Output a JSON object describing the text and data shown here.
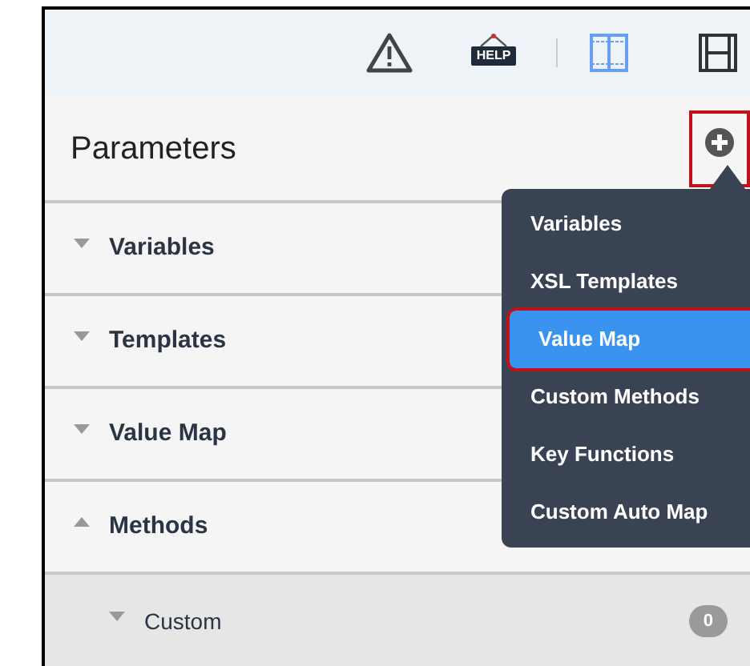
{
  "toolbar": {
    "help_sign_label": "HELP"
  },
  "panel": {
    "title": "Parameters",
    "add_button": {
      "highlighted": true
    }
  },
  "sections": [
    {
      "label": "Variables",
      "expanded": false
    },
    {
      "label": "Templates",
      "expanded": false
    },
    {
      "label": "Value Map",
      "expanded": false
    },
    {
      "label": "Methods",
      "expanded": true,
      "children": [
        {
          "label": "Custom",
          "expanded": false,
          "count": "0"
        }
      ]
    }
  ],
  "add_menu": {
    "items": [
      {
        "label": "Variables",
        "selected": false,
        "highlighted": false
      },
      {
        "label": "XSL Templates",
        "selected": false,
        "highlighted": false
      },
      {
        "label": "Value Map",
        "selected": true,
        "highlighted": true
      },
      {
        "label": "Custom Methods",
        "selected": false,
        "highlighted": false
      },
      {
        "label": "Key Functions",
        "selected": false,
        "highlighted": false
      },
      {
        "label": "Custom Auto Map",
        "selected": false,
        "highlighted": false
      }
    ]
  }
}
